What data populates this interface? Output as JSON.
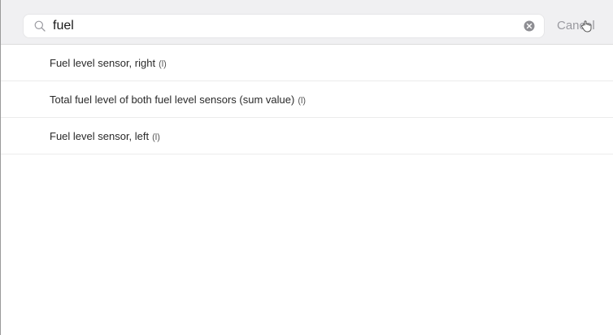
{
  "search": {
    "value": "fuel",
    "cancel_label": "Cancel"
  },
  "results": [
    {
      "label": "Fuel level sensor, right",
      "suffix": "(l)"
    },
    {
      "label": "Total fuel level of both fuel level sensors (sum value)",
      "suffix": "(l)"
    },
    {
      "label": "Fuel level sensor, left",
      "suffix": "(l)"
    }
  ],
  "colors": {
    "search_bar_bg": "#f0f0f2",
    "cancel_text": "#9a9aa0",
    "divider": "#ececec"
  },
  "icons": {
    "search": "magnifier-icon",
    "clear": "clear-circle-x-icon",
    "pointer": "hand-pointer-cursor-icon"
  }
}
